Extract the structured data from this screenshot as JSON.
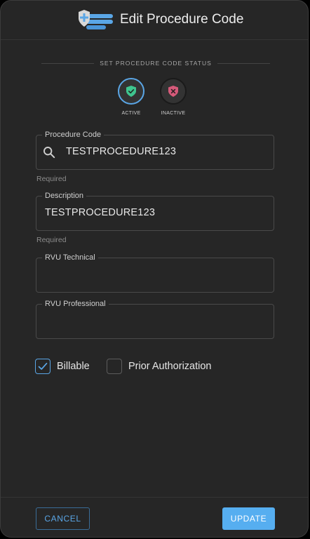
{
  "dialog": {
    "title": "Edit Procedure Code",
    "logo_icon": "medical-shield-list-icon"
  },
  "status": {
    "section_label": "SET PROCEDURE CODE STATUS",
    "selected": "active",
    "options": [
      {
        "label": "ACTIVE",
        "icon": "shield-check-icon",
        "color": "#3fc58f"
      },
      {
        "label": "INACTIVE",
        "icon": "shield-x-icon",
        "color": "#d65a7a"
      }
    ]
  },
  "fields": {
    "procedure_code": {
      "label": "Procedure Code",
      "value": "TESTPROCEDURE123",
      "helper": "Required",
      "icon": "search-icon"
    },
    "description": {
      "label": "Description",
      "value": "TESTPROCEDURE123",
      "helper": "Required"
    },
    "rvu_technical": {
      "label": "RVU Technical",
      "value": ""
    },
    "rvu_professional": {
      "label": "RVU Professional",
      "value": ""
    }
  },
  "checkboxes": {
    "billable": {
      "label": "Billable",
      "checked": true
    },
    "prior_authorization": {
      "label": "Prior Authorization",
      "checked": false
    }
  },
  "footer": {
    "cancel_label": "CANCEL",
    "update_label": "UPDATE"
  },
  "colors": {
    "accent": "#56aef0",
    "background": "#262626",
    "active_green": "#3fc58f",
    "inactive_red": "#d65a7a"
  }
}
